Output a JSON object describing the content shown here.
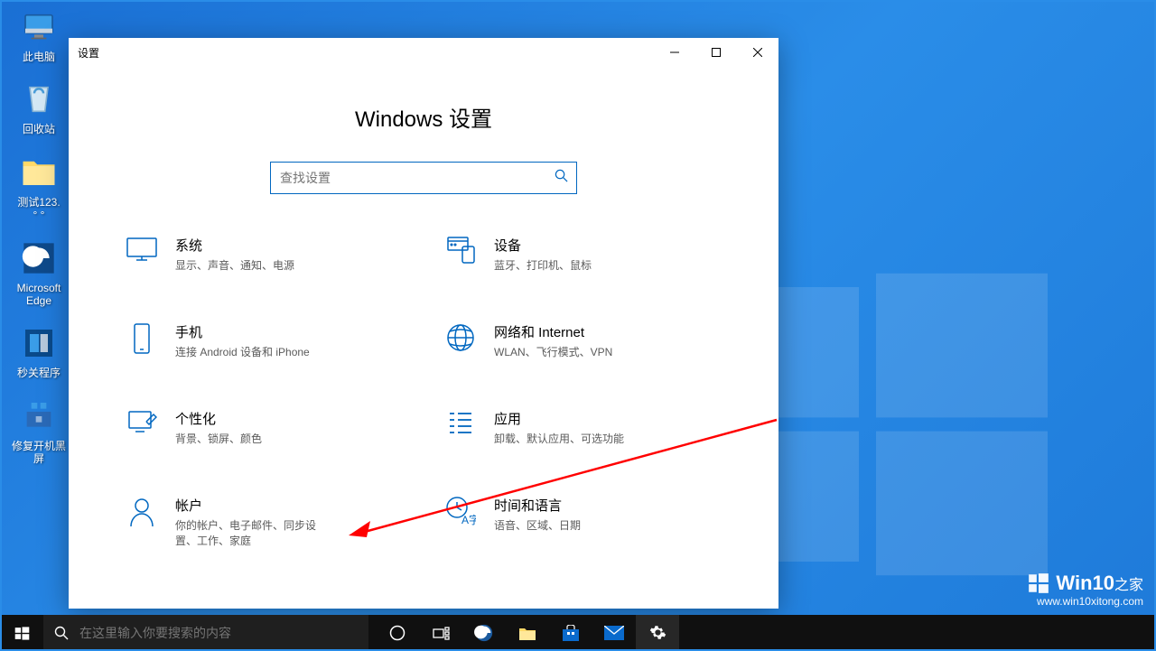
{
  "desktop": {
    "icons": [
      {
        "label": "此电脑",
        "name": "desktop-icon-this-pc"
      },
      {
        "label": "回收站",
        "name": "desktop-icon-recycle-bin"
      },
      {
        "label": "测试123.\n° °",
        "name": "desktop-icon-test-folder"
      },
      {
        "label": "Microsoft\nEdge",
        "name": "desktop-icon-edge"
      },
      {
        "label": "秒关程序",
        "name": "desktop-icon-quick-close"
      },
      {
        "label": "修复开机黑\n屏",
        "name": "desktop-icon-fix-boot"
      }
    ]
  },
  "settings": {
    "window_title": "设置",
    "header": "Windows 设置",
    "search_placeholder": "查找设置",
    "items": [
      {
        "title": "系统",
        "desc": "显示、声音、通知、电源",
        "name": "settings-item-system"
      },
      {
        "title": "设备",
        "desc": "蓝牙、打印机、鼠标",
        "name": "settings-item-devices"
      },
      {
        "title": "手机",
        "desc": "连接 Android 设备和 iPhone",
        "name": "settings-item-phone"
      },
      {
        "title": "网络和 Internet",
        "desc": "WLAN、飞行模式、VPN",
        "name": "settings-item-network"
      },
      {
        "title": "个性化",
        "desc": "背景、锁屏、颜色",
        "name": "settings-item-personalization"
      },
      {
        "title": "应用",
        "desc": "卸载、默认应用、可选功能",
        "name": "settings-item-apps"
      },
      {
        "title": "帐户",
        "desc": "你的帐户、电子邮件、同步设置、工作、家庭",
        "name": "settings-item-accounts"
      },
      {
        "title": "时间和语言",
        "desc": "语音、区域、日期",
        "name": "settings-item-time-language"
      }
    ]
  },
  "taskbar": {
    "search_placeholder": "在这里输入你要搜索的内容"
  },
  "watermark": {
    "main": "Win10",
    "suffix": "之家",
    "url": "www.win10xitong.com"
  }
}
